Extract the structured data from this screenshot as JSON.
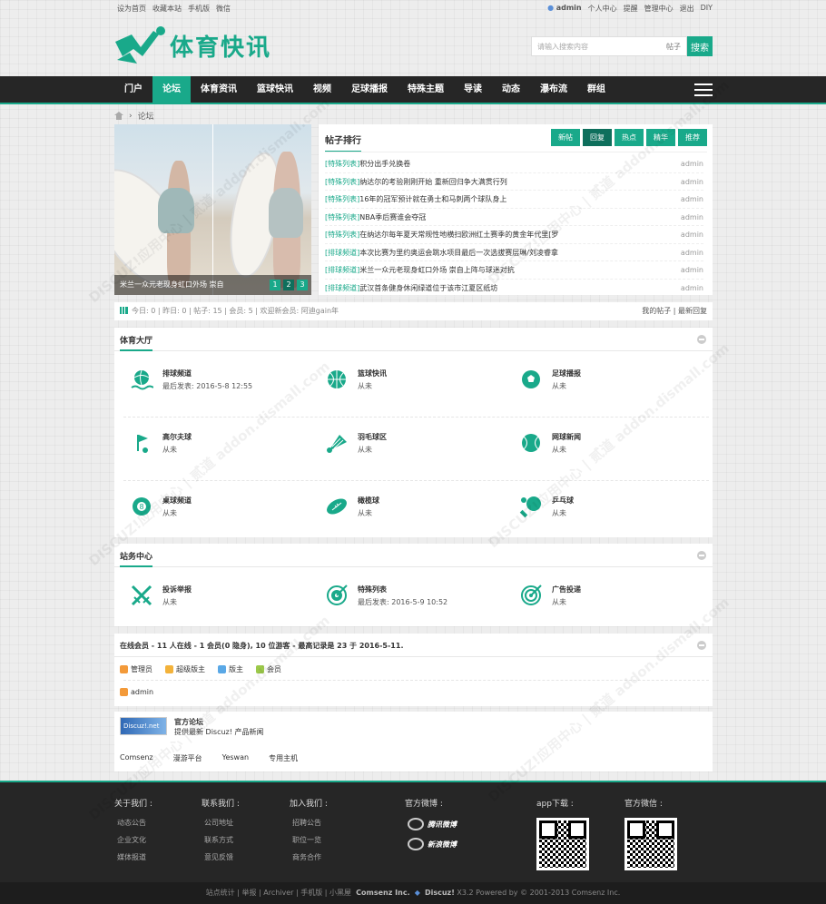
{
  "topbar": {
    "left": [
      "设为首页",
      "收藏本站",
      "手机版",
      "微信"
    ],
    "user": "admin",
    "right": [
      "个人中心",
      "提醒",
      "管理中心",
      "退出",
      "DIY"
    ]
  },
  "logo": {
    "text": "体育快讯"
  },
  "search": {
    "placeholder": "请输入搜索内容",
    "scope": "帖子",
    "button": "搜索"
  },
  "nav": [
    "门户",
    "论坛",
    "体育资讯",
    "篮球快讯",
    "视频",
    "足球播报",
    "特殊主题",
    "导读",
    "动态",
    "瀑布流",
    "群组"
  ],
  "crumb": "论坛",
  "slider": {
    "caption": "米兰一众元老现身虹口外场 崇自",
    "dots": [
      "1",
      "2",
      "3"
    ],
    "active": 1
  },
  "rank": {
    "title": "帖子排行",
    "tabs": [
      "新帖",
      "回复",
      "热点",
      "精华",
      "推荐"
    ],
    "active_tab": 1,
    "items": [
      {
        "cat": "[特殊列表]",
        "title": "积分出手兑换卷",
        "user": "admin"
      },
      {
        "cat": "[特殊列表]",
        "title": "纳达尔的考验刚刚开始 重新回归争大满贯行列",
        "user": "admin"
      },
      {
        "cat": "[特殊列表]",
        "title": "16年的冠军预计就在勇士和马刺两个球队身上",
        "user": "admin"
      },
      {
        "cat": "[特殊列表]",
        "title": "NBA季后赛谁会夺冠",
        "user": "admin"
      },
      {
        "cat": "[特殊列表]",
        "title": "在纳达尔每年夏天常规性地横扫欧洲红土赛季的黄金年代里[罗",
        "user": "admin"
      },
      {
        "cat": "[排球频道]",
        "title": "本次比赛为里约奥运会跳水项目最后一次选拔赛层琳/刘凌睿拿",
        "user": "admin"
      },
      {
        "cat": "[排球频道]",
        "title": "米兰一众元老现身虹口外场 崇自上阵与球迷对抗",
        "user": "admin"
      },
      {
        "cat": "[排球频道]",
        "title": "武汉首条健身休闲绿道位于该市江夏区纸坊",
        "user": "admin"
      }
    ]
  },
  "stats": {
    "text": "今日: 0 | 昨日: 0 | 帖子: 15 | 会员: 5 | 欢迎新会员: 阿迪gain年",
    "right": "我的帖子 | 最新回复"
  },
  "sports": {
    "title": "体育大厅",
    "forums": [
      {
        "name": "排球频道",
        "sub": "最后发表: 2016-5-8 12:55",
        "icon": "volleyball-icon"
      },
      {
        "name": "篮球快讯",
        "sub": "从未",
        "icon": "basketball-icon"
      },
      {
        "name": "足球播报",
        "sub": "从未",
        "icon": "football-icon"
      },
      {
        "name": "高尔夫球",
        "sub": "从未",
        "icon": "golf-icon"
      },
      {
        "name": "羽毛球区",
        "sub": "从未",
        "icon": "shuttlecock-icon"
      },
      {
        "name": "网球新闻",
        "sub": "从未",
        "icon": "tennis-icon"
      },
      {
        "name": "桌球频道",
        "sub": "从未",
        "icon": "billiards-icon"
      },
      {
        "name": "橄榄球",
        "sub": "从未",
        "icon": "rugby-icon"
      },
      {
        "name": "乒乓球",
        "sub": "从未",
        "icon": "pingpong-icon"
      }
    ]
  },
  "station": {
    "title": "站务中心",
    "forums": [
      {
        "name": "投诉举报",
        "sub": "从未",
        "icon": "crossed-swords-icon"
      },
      {
        "name": "特殊列表",
        "sub": "最后发表: 2016-5-9 10:52",
        "icon": "target-icon"
      },
      {
        "name": "广告投递",
        "sub": "从未",
        "icon": "dartboard-icon"
      }
    ]
  },
  "online": {
    "text": "在线会员 - 11 人在线 - 1 会员(0 隐身), 10 位游客 - 最高记录是 23 于 2016-5-11.",
    "roles": [
      {
        "name": "管理员",
        "color": "#f39a3a"
      },
      {
        "name": "超级版主",
        "color": "#f3b23a"
      },
      {
        "name": "版主",
        "color": "#5aa8e6"
      },
      {
        "name": "会员",
        "color": "#9cc94a"
      }
    ],
    "user": "admin"
  },
  "links": {
    "logo": "Discuz!.net",
    "title": "官方论坛",
    "desc": "提供最新 Discuz! 产品新闻",
    "items": [
      "Comsenz",
      "漫游平台",
      "Yeswan",
      "专用主机"
    ]
  },
  "footer": {
    "cols": [
      {
        "title": "关于我们 :",
        "items": [
          "动态公告",
          "企业文化",
          "媒体报道"
        ]
      },
      {
        "title": "联系我们 :",
        "items": [
          "公司地址",
          "联系方式",
          "意见反馈"
        ]
      },
      {
        "title": "加入我们 :",
        "items": [
          "招聘公告",
          "职位一览",
          "商务合作"
        ]
      }
    ],
    "weibo_title": "官方微博 :",
    "weibo": [
      "腾讯微博",
      "新浪微博"
    ],
    "app_title": "app下载 :",
    "wechat_title": "官方微信 :"
  },
  "bottom": {
    "links": "站点统计 | 举报 | Archiver | 手机版 | 小黑屋",
    "brand": "Comsenz Inc.",
    "powered_brand": "Discuz!",
    "powered": "X3.2 Powered by © 2001-2013 Comsenz Inc."
  },
  "watermark": "DISCUZ!应用中心 | 贰道 addon.dismall.com"
}
